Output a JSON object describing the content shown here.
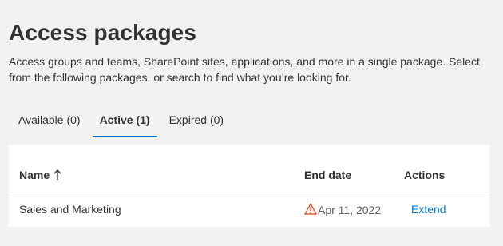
{
  "page": {
    "title": "Access packages",
    "description": "Access groups and teams, SharePoint sites, applications, and more in a single package. Select from the following packages, or search to find what you’re looking for."
  },
  "tabs": [
    {
      "label": "Available (0)",
      "active": false
    },
    {
      "label": "Active (1)",
      "active": true
    },
    {
      "label": "Expired (0)",
      "active": false
    }
  ],
  "table": {
    "columns": {
      "name": "Name",
      "end_date": "End date",
      "actions": "Actions"
    },
    "sort": {
      "column": "name",
      "direction": "ascending",
      "icon": "arrow-up-icon"
    },
    "rows": [
      {
        "name": "Sales and Marketing",
        "end_date": "Apr 11, 2022",
        "status_icon": "warning-icon",
        "action": "Extend"
      }
    ]
  },
  "colors": {
    "accent": "#0078d4",
    "warning": "#d83b01",
    "background": "#f3f2f1"
  }
}
